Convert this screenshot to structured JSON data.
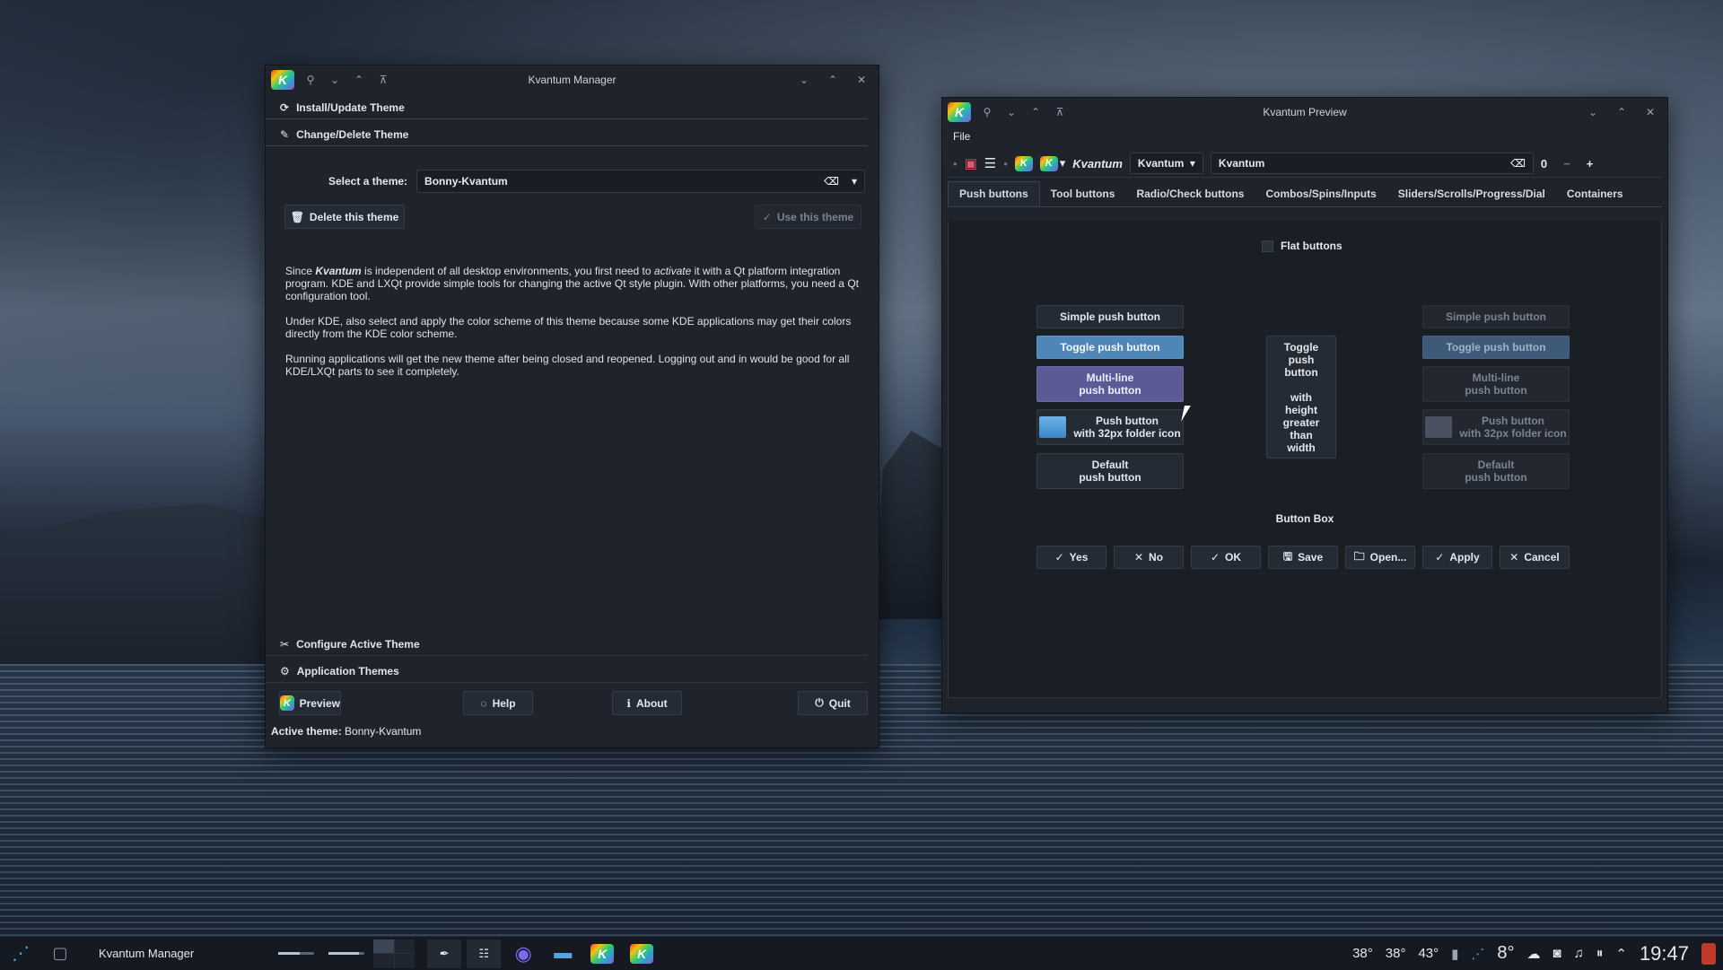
{
  "manager": {
    "title": "Kvantum Manager",
    "sections": {
      "install": "Install/Update Theme",
      "change": "Change/Delete Theme",
      "configure": "Configure Active Theme",
      "app_themes": "Application Themes"
    },
    "select_label": "Select a theme:",
    "selected_theme": "Bonny-Kvantum",
    "delete_button": "Delete this theme",
    "use_button": "Use this theme",
    "paragraph1_a": "Since ",
    "paragraph1_kv": "Kvantum",
    "paragraph1_b": " is independent of all desktop environments, you first need to ",
    "paragraph1_act": "activate",
    "paragraph1_c": " it with a Qt platform integration program. KDE and LXQt provide simple tools for changing the active Qt style plugin. With other platforms, you need a Qt configuration tool.",
    "paragraph2": "Under KDE, also select and apply the color scheme of this theme because some KDE applications may get their colors directly from the KDE color scheme.",
    "paragraph3": "Running applications will get the new theme after being closed and reopened. Logging out and in would be good for all KDE/LXQt parts to see it completely.",
    "buttons": {
      "preview": "Preview",
      "help": "Help",
      "about": "About",
      "quit": "Quit"
    },
    "status_label": "Active theme:",
    "status_value": "Bonny-Kvantum"
  },
  "preview": {
    "title": "Kvantum Preview",
    "menu": {
      "file": "File"
    },
    "toolbar": {
      "label_italic": "Kvantum",
      "combo_value": "Kvantum",
      "line_edit": "Kvantum",
      "spin_value": "0"
    },
    "tabs": [
      "Push buttons",
      "Tool buttons",
      "Radio/Check buttons",
      "Combos/Spins/Inputs",
      "Sliders/Scrolls/Progress/Dial",
      "Containers"
    ],
    "flat_buttons": "Flat buttons",
    "left_buttons": {
      "simple": "Simple push button",
      "toggle": "Toggle push button",
      "multi1": "Multi-line",
      "multi2": "push button",
      "folder1": "Push button",
      "folder2": "with 32px folder icon",
      "default1": "Default",
      "default2": "push button"
    },
    "tall_button": [
      "Toggle",
      "push",
      "button",
      "",
      "with",
      "height",
      "greater",
      "than",
      "width"
    ],
    "button_box_title": "Button Box",
    "button_box": [
      {
        "icon": "✓",
        "label": "Yes"
      },
      {
        "icon": "✕",
        "label": "No"
      },
      {
        "icon": "✓",
        "label": "OK"
      },
      {
        "icon": "🖫",
        "label": "Save"
      },
      {
        "icon": "🗀",
        "label": "Open..."
      },
      {
        "icon": "✓",
        "label": "Apply"
      },
      {
        "icon": "✕",
        "label": "Cancel"
      }
    ]
  },
  "taskbar": {
    "active_task": "Kvantum Manager",
    "temps": [
      "38°",
      "38°",
      "43°"
    ],
    "weather": "8°",
    "clock": "19:47"
  }
}
